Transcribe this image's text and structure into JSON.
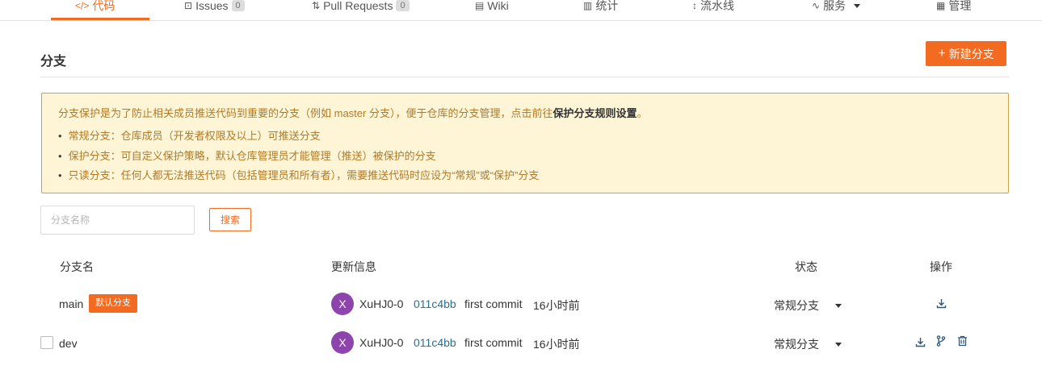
{
  "tabs": [
    {
      "label": "代码",
      "icon": "code-icon",
      "glyph": "</>",
      "active": true
    },
    {
      "label": "Issues",
      "icon": "issues-icon",
      "glyph": "⊡",
      "count": "0"
    },
    {
      "label": "Pull Requests",
      "icon": "pull-request-icon",
      "glyph": "⇅",
      "count": "0"
    },
    {
      "label": "Wiki",
      "icon": "wiki-icon",
      "glyph": "▤"
    },
    {
      "label": "统计",
      "icon": "stats-icon",
      "glyph": "▥"
    },
    {
      "label": "流水线",
      "icon": "pipeline-icon",
      "glyph": "↕"
    },
    {
      "label": "服务",
      "icon": "service-icon",
      "glyph": "∿"
    },
    {
      "label": "管理",
      "icon": "manage-icon",
      "glyph": "▦"
    }
  ],
  "section": {
    "title": "分支",
    "new_branch_label": "新建分支"
  },
  "notice": {
    "intro_prefix": "分支保护是为了防止相关成员推送代码到重要的分支（例如 master 分支），便于仓库的分支管理，点击前往",
    "intro_link": "保护分支规则设置",
    "intro_suffix": "。",
    "items": [
      "常规分支：仓库成员（开发者权限及以上）可推送分支",
      "保护分支：可自定义保护策略，默认仓库管理员才能管理（推送）被保护的分支",
      "只读分支：任何人都无法推送代码（包括管理员和所有者），需要推送代码时应设为“常规”或“保护”分支"
    ],
    "bullet": "•"
  },
  "search": {
    "placeholder": "分支名称",
    "value": "",
    "button_label": "搜索"
  },
  "table": {
    "headers": {
      "name": "分支名",
      "update": "更新信息",
      "status": "状态",
      "actions": "操作"
    },
    "rows": [
      {
        "name": "main",
        "badge": "默认分支",
        "avatar": "X",
        "author": "XuHJ0-0",
        "sha": "011c4bb",
        "message": "first commit",
        "time": "16小时前",
        "status": "常规分支"
      },
      {
        "name": "dev",
        "avatar": "X",
        "author": "XuHJ0-0",
        "sha": "011c4bb",
        "message": "first commit",
        "time": "16小时前",
        "status": "常规分支"
      }
    ]
  },
  "colors": {
    "accent": "#f26b21",
    "avatar": "#8e44ad",
    "sha": "#2a6f8f",
    "notice_bg": "#fdf5d6",
    "notice_text": "#b07a2a"
  }
}
